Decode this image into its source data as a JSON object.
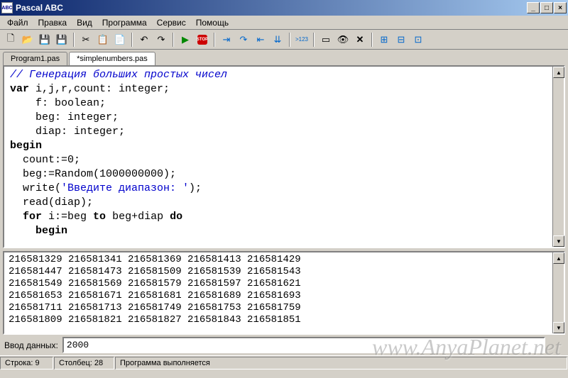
{
  "title": "Pascal ABC",
  "menu": [
    "Файл",
    "Правка",
    "Вид",
    "Программа",
    "Сервис",
    "Помощь"
  ],
  "tabs": [
    {
      "label": "Program1.pas",
      "active": false
    },
    {
      "label": "*simplenumbers.pas",
      "active": true
    }
  ],
  "code": {
    "l1_comment": "// Генерация больших простых чисел",
    "l2_kw": "var",
    "l2_rest": " i,j,r,count: integer;",
    "l3": "    f: boolean;",
    "l4": "    beg: integer;",
    "l5": "    diap: integer;",
    "l6_kw": "begin",
    "l7": "  count:=0;",
    "l8": "  beg:=Random(1000000000);",
    "l9a": "  write(",
    "l9s": "'Введите диапазон: '",
    "l9b": ");",
    "l10": "  read(diap);",
    "l11a": "  ",
    "l11_for": "for",
    "l11b": " i:=beg ",
    "l11_to": "to",
    "l11c": " beg+diap ",
    "l11_do": "do",
    "l12a": "    ",
    "l12_kw": "begin"
  },
  "output_lines": [
    "216581329 216581341 216581369 216581413 216581429",
    "216581447 216581473 216581509 216581539 216581543",
    "216581549 216581569 216581579 216581597 216581621",
    "216581653 216581671 216581681 216581689 216581693",
    "216581711 216581713 216581749 216581753 216581759",
    "216581809 216581821 216581827 216581843 216581851"
  ],
  "input": {
    "label": "Ввод данных:",
    "value": "2000"
  },
  "status": {
    "line": "Строка: 9",
    "col": "Столбец: 28",
    "msg": "Программа выполняется"
  },
  "watermark": "www.AnyaPlanet.net"
}
